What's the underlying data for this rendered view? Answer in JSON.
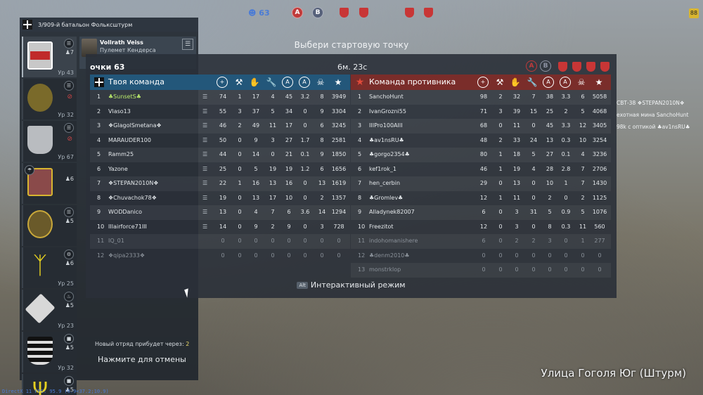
{
  "top": {
    "player_count": "63",
    "caps": [
      "A",
      "B"
    ],
    "shields": [
      "",
      "",
      "",
      ""
    ],
    "corner_badge": "88"
  },
  "battalion": {
    "name": "3/909-й батальон Фольксштурм",
    "squads": [
      {
        "count": "7",
        "level": "Ур 43",
        "icon": "doc"
      },
      {
        "count": "",
        "level": "Ур 32",
        "icon": "ban"
      },
      {
        "count": "",
        "level": "Ур 67",
        "icon": "ban"
      },
      {
        "count": "6",
        "level": "",
        "icon": "doc"
      },
      {
        "count": "5",
        "level": "",
        "icon": "doc"
      },
      {
        "count": "6",
        "level": "Ур 25",
        "icon": "vehicle"
      },
      {
        "count": "5",
        "level": "Ур 23",
        "icon": "fire"
      },
      {
        "count": "5",
        "level": "Ур 32",
        "icon": "tank"
      },
      {
        "count": "5",
        "level": "",
        "icon": "tank"
      }
    ],
    "soldier": {
      "name": "Vollrath Veiss",
      "role": "Пулемет Кендерса"
    },
    "arrival_label": "Новый отряд прибудет через:",
    "arrival_time": "2",
    "cancel_label": "Нажмите для отмены"
  },
  "choose_label": "Выбери стартовую точку",
  "board": {
    "score_label": "очки 63",
    "time": "6м. 23с",
    "ours": {
      "title": "Твоя команда",
      "rows": [
        {
          "idx": "1",
          "name": "♣SunsetS♣",
          "v": [
            "74",
            "1",
            "17",
            "4",
            "45",
            "3.2",
            "8",
            "3949"
          ],
          "hl": true
        },
        {
          "idx": "2",
          "name": "Vlaso13",
          "v": [
            "55",
            "3",
            "37",
            "5",
            "34",
            "0",
            "9",
            "3304"
          ]
        },
        {
          "idx": "3",
          "name": "❖GlagolSmetana❖",
          "v": [
            "46",
            "2",
            "49",
            "11",
            "17",
            "0",
            "6",
            "3245"
          ]
        },
        {
          "idx": "4",
          "name": "MARAUDER100",
          "v": [
            "50",
            "0",
            "9",
            "3",
            "27",
            "1.7",
            "8",
            "2581"
          ]
        },
        {
          "idx": "5",
          "name": "Ramm25",
          "v": [
            "44",
            "0",
            "14",
            "0",
            "21",
            "0.1",
            "9",
            "1850"
          ]
        },
        {
          "idx": "6",
          "name": "Yazone",
          "v": [
            "25",
            "0",
            "5",
            "19",
            "19",
            "1.2",
            "6",
            "1656"
          ]
        },
        {
          "idx": "7",
          "name": "❖STEPAN2010N❖",
          "v": [
            "22",
            "1",
            "16",
            "13",
            "16",
            "0",
            "13",
            "1619"
          ]
        },
        {
          "idx": "8",
          "name": "❖Chuvachok78❖",
          "v": [
            "19",
            "0",
            "13",
            "17",
            "10",
            "0",
            "2",
            "1357"
          ]
        },
        {
          "idx": "9",
          "name": "WODDanico",
          "v": [
            "13",
            "0",
            "4",
            "7",
            "6",
            "3.6",
            "14",
            "1294"
          ]
        },
        {
          "idx": "10",
          "name": "IIIairforce71III",
          "v": [
            "14",
            "0",
            "9",
            "2",
            "9",
            "0",
            "3",
            "728"
          ]
        },
        {
          "idx": "11",
          "name": "IQ_01",
          "v": [
            "0",
            "0",
            "0",
            "0",
            "0",
            "0",
            "0",
            "0"
          ],
          "dim": true
        },
        {
          "idx": "12",
          "name": "❖qipa2333❖",
          "v": [
            "0",
            "0",
            "0",
            "0",
            "0",
            "0",
            "0",
            "0"
          ],
          "dim": true
        }
      ]
    },
    "enemy": {
      "title": "Команда противника",
      "rows": [
        {
          "idx": "1",
          "name": "SanchoHunt",
          "v": [
            "98",
            "2",
            "32",
            "7",
            "38",
            "3.3",
            "6",
            "5058"
          ]
        },
        {
          "idx": "2",
          "name": "IvanGrozni55",
          "v": [
            "71",
            "3",
            "39",
            "15",
            "25",
            "2",
            "5",
            "4068"
          ]
        },
        {
          "idx": "3",
          "name": "IIIPro100AIII",
          "v": [
            "68",
            "0",
            "11",
            "0",
            "45",
            "3.3",
            "12",
            "3405"
          ]
        },
        {
          "idx": "4",
          "name": "♣av1nsRU♣",
          "v": [
            "48",
            "2",
            "33",
            "24",
            "13",
            "0.3",
            "10",
            "3254"
          ]
        },
        {
          "idx": "5",
          "name": "♣gorgo2354♣",
          "v": [
            "80",
            "1",
            "18",
            "5",
            "27",
            "0.1",
            "4",
            "3236"
          ]
        },
        {
          "idx": "6",
          "name": "kef1rok_1",
          "v": [
            "46",
            "1",
            "19",
            "4",
            "28",
            "2.8",
            "7",
            "2706"
          ]
        },
        {
          "idx": "7",
          "name": "hen_cerbin",
          "v": [
            "29",
            "0",
            "13",
            "0",
            "10",
            "1",
            "7",
            "1430"
          ]
        },
        {
          "idx": "8",
          "name": "♣Gromlev♣",
          "v": [
            "12",
            "1",
            "11",
            "0",
            "2",
            "0",
            "2",
            "1125"
          ]
        },
        {
          "idx": "9",
          "name": "Alladynek82007",
          "v": [
            "6",
            "0",
            "3",
            "31",
            "5",
            "0.9",
            "5",
            "1076"
          ]
        },
        {
          "idx": "10",
          "name": "Freezitot",
          "v": [
            "12",
            "0",
            "3",
            "0",
            "8",
            "0.3",
            "11",
            "560"
          ]
        },
        {
          "idx": "11",
          "name": "indohomanishere",
          "v": [
            "6",
            "0",
            "2",
            "2",
            "3",
            "0",
            "1",
            "277"
          ],
          "dim": true
        },
        {
          "idx": "12",
          "name": "♣denm2010♣",
          "v": [
            "0",
            "0",
            "0",
            "0",
            "0",
            "0",
            "0",
            "0"
          ],
          "dim": true
        },
        {
          "idx": "13",
          "name": "monstrklop",
          "v": [
            "0",
            "0",
            "0",
            "0",
            "0",
            "0",
            "0",
            "0"
          ],
          "dim": true
        }
      ]
    },
    "interactive_key": "Alt",
    "interactive_label": "Интерактивный режим"
  },
  "killfeed": [
    "СВТ-38 ❖STEPAN2010N❖",
    "ехотная мина SanchoHunt",
    "98k с оптикой ♣av1nsRU♣"
  ],
  "map_name": "Улица Гоголя Юг (Штурм)",
  "debug": "DirectX 11 FPS: 95.9 (6.9<37.2;10.9)"
}
